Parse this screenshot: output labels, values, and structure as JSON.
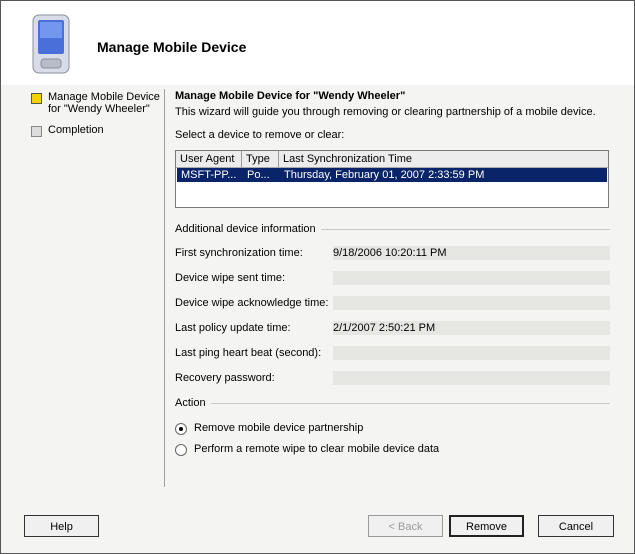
{
  "window": {
    "title": "Manage Mobile Device"
  },
  "nav": {
    "steps": [
      {
        "label": "Manage Mobile Device\nfor \"Wendy Wheeler\"",
        "active": true
      },
      {
        "label": "Completion",
        "active": false
      }
    ]
  },
  "main": {
    "heading": "Manage Mobile Device for \"Wendy Wheeler\"",
    "description": "This wizard will guide you through removing or clearing partnership of a mobile device.",
    "select_label": "Select a device to remove or clear:",
    "device_table": {
      "columns": [
        "User Agent",
        "Type",
        "Last Synchronization Time"
      ],
      "rows": [
        {
          "user_agent": "MSFT-PP...",
          "type": "Po...",
          "last_sync": "Thursday, February 01, 2007 2:33:59 PM",
          "selected": true
        }
      ]
    },
    "additional_info": {
      "title": "Additional device information",
      "fields": [
        {
          "label": "First synchronization time:",
          "value": "9/18/2006 10:20:11 PM"
        },
        {
          "label": "Device wipe sent time:",
          "value": ""
        },
        {
          "label": "Device wipe acknowledge time:",
          "value": ""
        },
        {
          "label": "Last policy update time:",
          "value": "2/1/2007 2:50:21 PM"
        },
        {
          "label": "Last ping heart beat (second):",
          "value": ""
        },
        {
          "label": "Recovery password:",
          "value": ""
        }
      ]
    },
    "action": {
      "title": "Action",
      "options": [
        {
          "label": "Remove mobile device partnership",
          "selected": true
        },
        {
          "label": "Perform a remote wipe to clear mobile device data",
          "selected": false
        }
      ]
    }
  },
  "buttons": {
    "help": "Help",
    "back": "< Back",
    "remove": "Remove",
    "cancel": "Cancel"
  },
  "colors": {
    "selection": "#0a246a",
    "active_step": "#f2d200"
  }
}
